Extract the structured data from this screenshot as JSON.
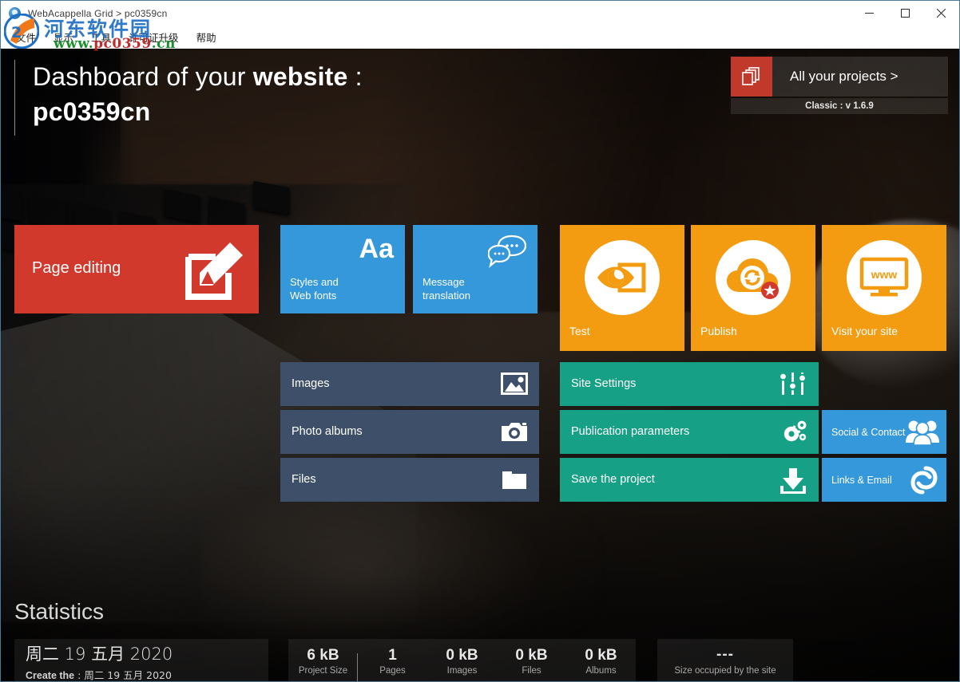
{
  "window": {
    "title": "WebAcappella Grid > pc0359cn",
    "app_icon": "app-logo-icon",
    "minimize": "minimize-icon",
    "maximize": "maximize-icon",
    "close": "close-icon"
  },
  "menu": {
    "items": [
      {
        "label": "文件"
      },
      {
        "label": "显示"
      },
      {
        "label": "工具"
      },
      {
        "label": "许可证升级"
      },
      {
        "label": "帮助"
      }
    ]
  },
  "watermark": {
    "chinese": "河东软件园",
    "url_prefix": "www.",
    "url_domain": "pc0359",
    "url_suffix": ".cn"
  },
  "header": {
    "title_lead": "Dashboard of your ",
    "title_bold": "website",
    "title_sep": " :",
    "project_name": "pc0359cn",
    "projects_button": "All your projects >",
    "projects_icon": "documents-stack-icon",
    "version": "Classic : v 1.6.9"
  },
  "tiles": {
    "page_editing": {
      "label": "Page editing",
      "icon": "edit-pencil-square-icon",
      "color": "#d0392b"
    },
    "styles": {
      "label": "Styles and\nWeb fonts",
      "glyph": "Aa",
      "color": "#3498db"
    },
    "message_translation": {
      "label": "Message\ntranslation",
      "icon": "speech-bubbles-icon",
      "color": "#3498db"
    },
    "test": {
      "label": "Test",
      "icon": "eye-preview-icon",
      "color": "#f39c12"
    },
    "publish": {
      "label": "Publish",
      "icon": "cloud-sync-star-icon",
      "color": "#f39c12"
    },
    "visit": {
      "label": "Visit your site",
      "icon": "monitor-www-icon",
      "color": "#f39c12"
    },
    "images": {
      "label": "Images",
      "icon": "picture-icon",
      "color": "#3e5069"
    },
    "photo_albums": {
      "label": "Photo albums",
      "icon": "camera-icon",
      "color": "#3e5069"
    },
    "files": {
      "label": "Files",
      "icon": "folder-icon",
      "color": "#3e5069"
    },
    "site_settings": {
      "label": "Site Settings",
      "icon": "sliders-icon",
      "color": "#16a085"
    },
    "publication_parameters": {
      "label": "Publication parameters",
      "icon": "gears-icon",
      "color": "#16a085"
    },
    "save_project": {
      "label": "Save the project",
      "icon": "download-save-icon",
      "color": "#16a085"
    },
    "social_contact": {
      "label": "Social & Contact",
      "icon": "people-group-icon",
      "color": "#3498db"
    },
    "links_email": {
      "label": "Links & Email",
      "icon": "chain-link-icon",
      "color": "#3498db"
    }
  },
  "statistics": {
    "heading": "Statistics",
    "current_date": "周二 19 五月 2020",
    "created_label": "Create the",
    "created_sep": " : ",
    "created_date": "周二 19 五月 2020",
    "cells": [
      {
        "value": "6 kB",
        "key": "Project Size"
      },
      {
        "value": "1",
        "key": "Pages"
      },
      {
        "value": "0 kB",
        "key": "Images"
      },
      {
        "value": "0 kB",
        "key": "Files"
      },
      {
        "value": "0 kB",
        "key": "Albums"
      }
    ],
    "site_size": {
      "value": "---",
      "key": "Size occupied by the site"
    }
  }
}
